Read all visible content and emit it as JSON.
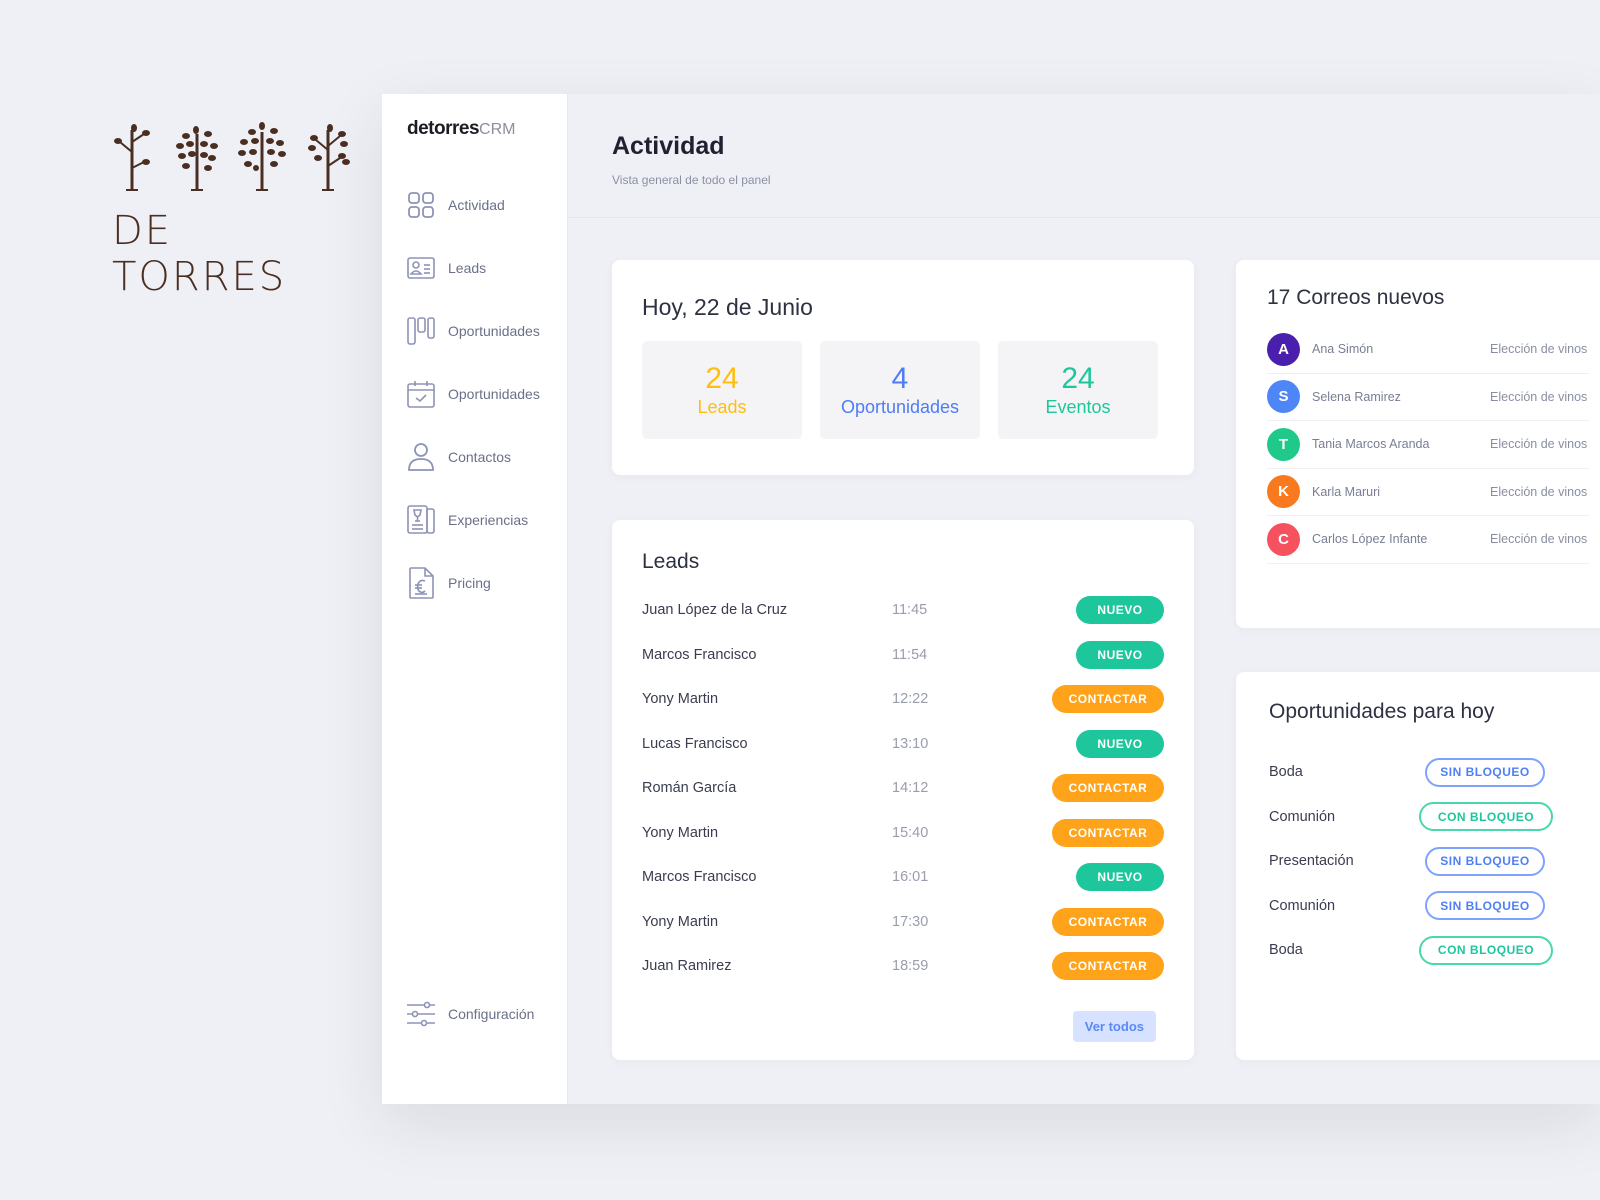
{
  "brand": {
    "name": "DE TORRES"
  },
  "sidebar": {
    "logo_bold": "detorres",
    "logo_light": "CRM",
    "items": [
      {
        "label": "Actividad",
        "icon": "grid-icon"
      },
      {
        "label": "Leads",
        "icon": "id-card-icon"
      },
      {
        "label": "Oportunidades",
        "icon": "kanban-icon"
      },
      {
        "label": "Oportunidades",
        "icon": "calendar-check-icon"
      },
      {
        "label": "Contactos",
        "icon": "user-icon"
      },
      {
        "label": "Experiencias",
        "icon": "wine-brochure-icon"
      },
      {
        "label": "Pricing",
        "icon": "euro-document-icon"
      }
    ],
    "settings": {
      "label": "Configuración",
      "icon": "sliders-icon"
    }
  },
  "header": {
    "title": "Actividad",
    "subtitle": "Vista general de todo el panel"
  },
  "today": {
    "title": "Hoy, 22 de Junio",
    "stats": [
      {
        "value": "24",
        "label": "Leads",
        "color": "#ffbe0b"
      },
      {
        "value": "4",
        "label": "Oportunidades",
        "color": "#4e7cf5"
      },
      {
        "value": "24",
        "label": "Eventos",
        "color": "#1ec79b"
      }
    ]
  },
  "leads": {
    "title": "Leads",
    "rows": [
      {
        "name": "Juan López de la Cruz",
        "time": "11:45",
        "status": "NUEVO",
        "type": "nuevo"
      },
      {
        "name": "Marcos Francisco",
        "time": "11:54",
        "status": "NUEVO",
        "type": "nuevo"
      },
      {
        "name": "Yony Martin",
        "time": "12:22",
        "status": "CONTACTAR",
        "type": "contactar"
      },
      {
        "name": "Lucas Francisco",
        "time": "13:10",
        "status": "NUEVO",
        "type": "nuevo"
      },
      {
        "name": "Román García",
        "time": "14:12",
        "status": "CONTACTAR",
        "type": "contactar"
      },
      {
        "name": "Yony Martin",
        "time": "15:40",
        "status": "CONTACTAR",
        "type": "contactar"
      },
      {
        "name": "Marcos Francisco",
        "time": "16:01",
        "status": "NUEVO",
        "type": "nuevo"
      },
      {
        "name": "Yony Martin",
        "time": "17:30",
        "status": "CONTACTAR",
        "type": "contactar"
      },
      {
        "name": "Juan Ramirez",
        "time": "18:59",
        "status": "CONTACTAR",
        "type": "contactar"
      }
    ],
    "view_all": "Ver todos"
  },
  "mails": {
    "title": "17 Correos nuevos",
    "rows": [
      {
        "initial": "A",
        "name": "Ana Simón",
        "subject": "Elección de vinos",
        "color": "#4b1fae"
      },
      {
        "initial": "S",
        "name": "Selena Ramirez",
        "subject": "Elección de vinos",
        "color": "#4f86f7"
      },
      {
        "initial": "T",
        "name": "Tania Marcos Aranda",
        "subject": "Elección de vinos",
        "color": "#1ec98a"
      },
      {
        "initial": "K",
        "name": "Karla Maruri",
        "subject": "Elección de vinos",
        "color": "#f8791e"
      },
      {
        "initial": "C",
        "name": "Carlos López Infante",
        "subject": "Elección de vinos",
        "color": "#f5515f"
      }
    ]
  },
  "opportunities": {
    "title": "Oportunidades para hoy",
    "rows": [
      {
        "name": "Boda",
        "status": "SIN BLOQUEO",
        "type": "sin"
      },
      {
        "name": "Comunión",
        "status": "CON BLOQUEO",
        "type": "con"
      },
      {
        "name": "Presentación",
        "status": "SIN BLOQUEO",
        "type": "sin"
      },
      {
        "name": "Comunión",
        "status": "SIN BLOQUEO",
        "type": "sin"
      },
      {
        "name": "Boda",
        "status": "CON BLOQUEO",
        "type": "con"
      }
    ]
  }
}
